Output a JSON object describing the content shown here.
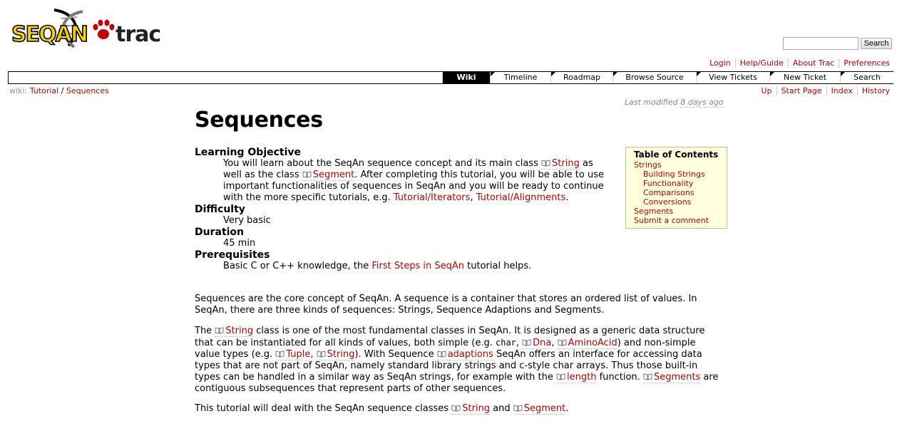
{
  "header": {
    "logo_primary": "SEQAN",
    "logo_secondary": "trac",
    "search_button": "Search",
    "search_value": ""
  },
  "metanav": [
    "Login",
    "Help/Guide",
    "About Trac",
    "Preferences"
  ],
  "mainnav": [
    "Wiki",
    "Timeline",
    "Roadmap",
    "Browse Source",
    "View Tickets",
    "New Ticket",
    "Search"
  ],
  "breadcrumb": {
    "prefix": "wiki:",
    "parent": "Tutorial",
    "sep": "/",
    "current": "Sequences"
  },
  "ctxtnav": [
    "Up",
    "Start Page",
    "Index",
    "History"
  ],
  "last_modified": {
    "label": "Last modified",
    "ago": "8 days ago"
  },
  "page": {
    "title": "Sequences",
    "defs": {
      "objective_term": "Learning Objective",
      "objective_1": "You will learn about the SeqAn sequence concept and its main class ",
      "string": "String",
      "objective_2": " as well as the class ",
      "segment": "Segment",
      "objective_3": ". After completing this tutorial, you will be able to use important functionalities of sequences in SeqAn and you will be ready to continue with the more specific tutorials, e.g. ",
      "iterators": "Tutorial/Iterators",
      "comma": ",",
      "alignments": "Tutorial/Alignments",
      "period": ".",
      "difficulty_term": "Difficulty",
      "difficulty": "Very basic",
      "duration_term": "Duration",
      "duration": "45 min",
      "prereq_term": "Prerequisites",
      "prereq_1": "Basic C or C++ knowledge, the ",
      "first_steps": "First Steps in SeqAn",
      "prereq_2": " tutorial helps."
    },
    "p1": "Sequences are the core concept of SeqAn. A sequence is a container that stores an ordered list of values. In SeqAn, there are three kinds of sequences: Strings, Sequence Adaptions and Segments.",
    "p2": {
      "t1": "The ",
      "string": "String",
      "t2": " class is one of the most fundamental classes in SeqAn. It is designed as a generic data structure that can be instantiated for all kinds of values, both simple (e.g. ",
      "char": "char",
      "t3": ", ",
      "dna": "Dna",
      "t4": ", ",
      "amino": "AminoAcid",
      "t5": ") and non-simple value types (e.g. ",
      "tuple": "Tuple",
      "t6": ", ",
      "string2": "String",
      "t7": "). With Sequence ",
      "adaptions": "adaptions",
      "t8": " SeqAn offers an interface for accessing data types that are not part of SeqAn, namely standard library strings and c-style char arrays. Thus those built-in types can be handled in a similar way as SeqAn strings, for example with the ",
      "length": "length",
      "t9": " function. ",
      "segments": "Segments",
      "t10": " are contiguous subsequences that represent parts of other sequences."
    },
    "p3": {
      "t1": "This tutorial will deal with the SeqAn sequence classes ",
      "string": "String",
      "t2": " and ",
      "segment": "Segment",
      "t3": "."
    }
  },
  "toc": {
    "title": "Table of Contents",
    "items": [
      {
        "label": "Strings",
        "level": 1
      },
      {
        "label": "Building Strings",
        "level": 2
      },
      {
        "label": "Functionality",
        "level": 2
      },
      {
        "label": "Comparisons",
        "level": 2
      },
      {
        "label": "Conversions",
        "level": 2
      },
      {
        "label": "Segments",
        "level": 1
      },
      {
        "label": "Submit a comment",
        "level": 1
      }
    ]
  },
  "colors": {
    "link": "#bb0000",
    "toc_bg": "#ffffdd",
    "logo_yellow": "#f5d000",
    "paw_red": "#c00000"
  }
}
